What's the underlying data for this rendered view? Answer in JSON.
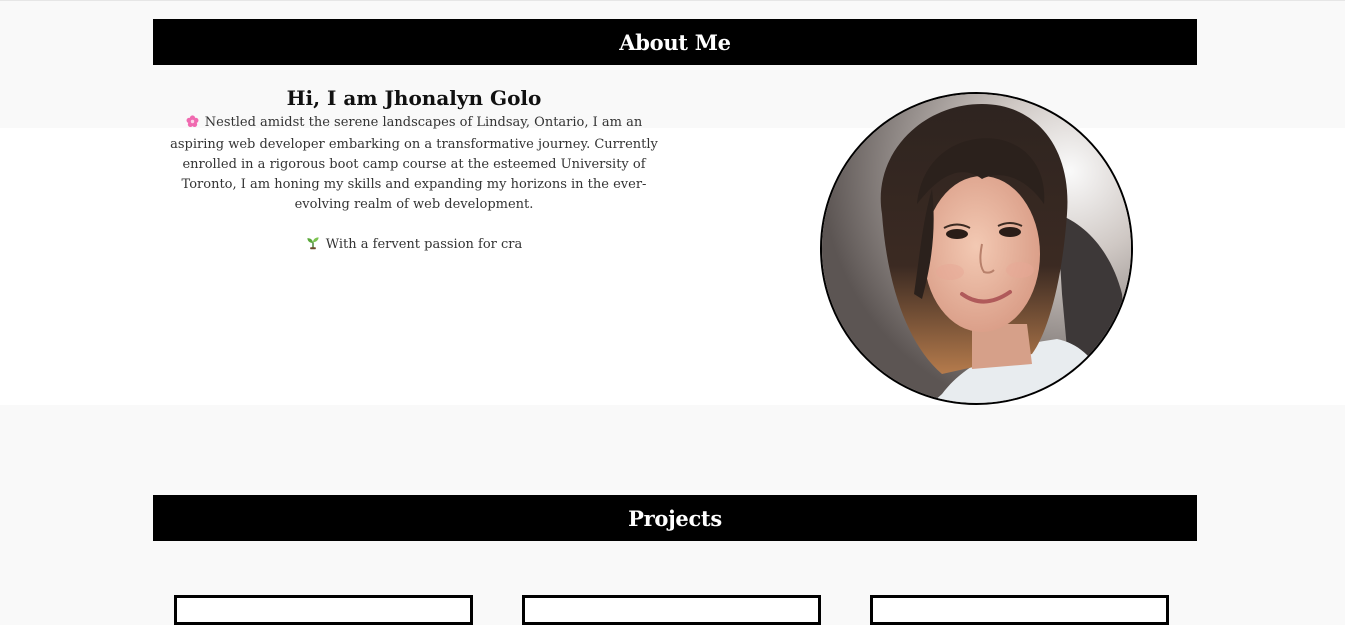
{
  "about": {
    "header": "About Me",
    "greeting": "Hi, I am Jhonalyn Golo",
    "paragraph1_icon": "cherry-blossom-icon",
    "paragraph1": "Nestled amidst the serene landscapes of Lindsay, Ontario, I am an aspiring web developer embarking on a transformative journey. Currently enrolled in a rigorous boot camp course at the esteemed University of Toronto, I am honing my skills and expanding my horizons in the ever-evolving realm of web development.",
    "paragraph2_icon": "seedling-icon",
    "paragraph2": "With a fervent passion for cra",
    "photo_name": "profile-photo"
  },
  "projects": {
    "header": "Projects",
    "cards": [
      {
        "name": "project-card-1"
      },
      {
        "name": "project-card-2"
      },
      {
        "name": "project-card-3"
      }
    ]
  },
  "colors": {
    "header_bg": "#000000",
    "header_text": "#ffffff",
    "page_bg": "#f9f9f9",
    "band_bg": "#ffffff"
  }
}
